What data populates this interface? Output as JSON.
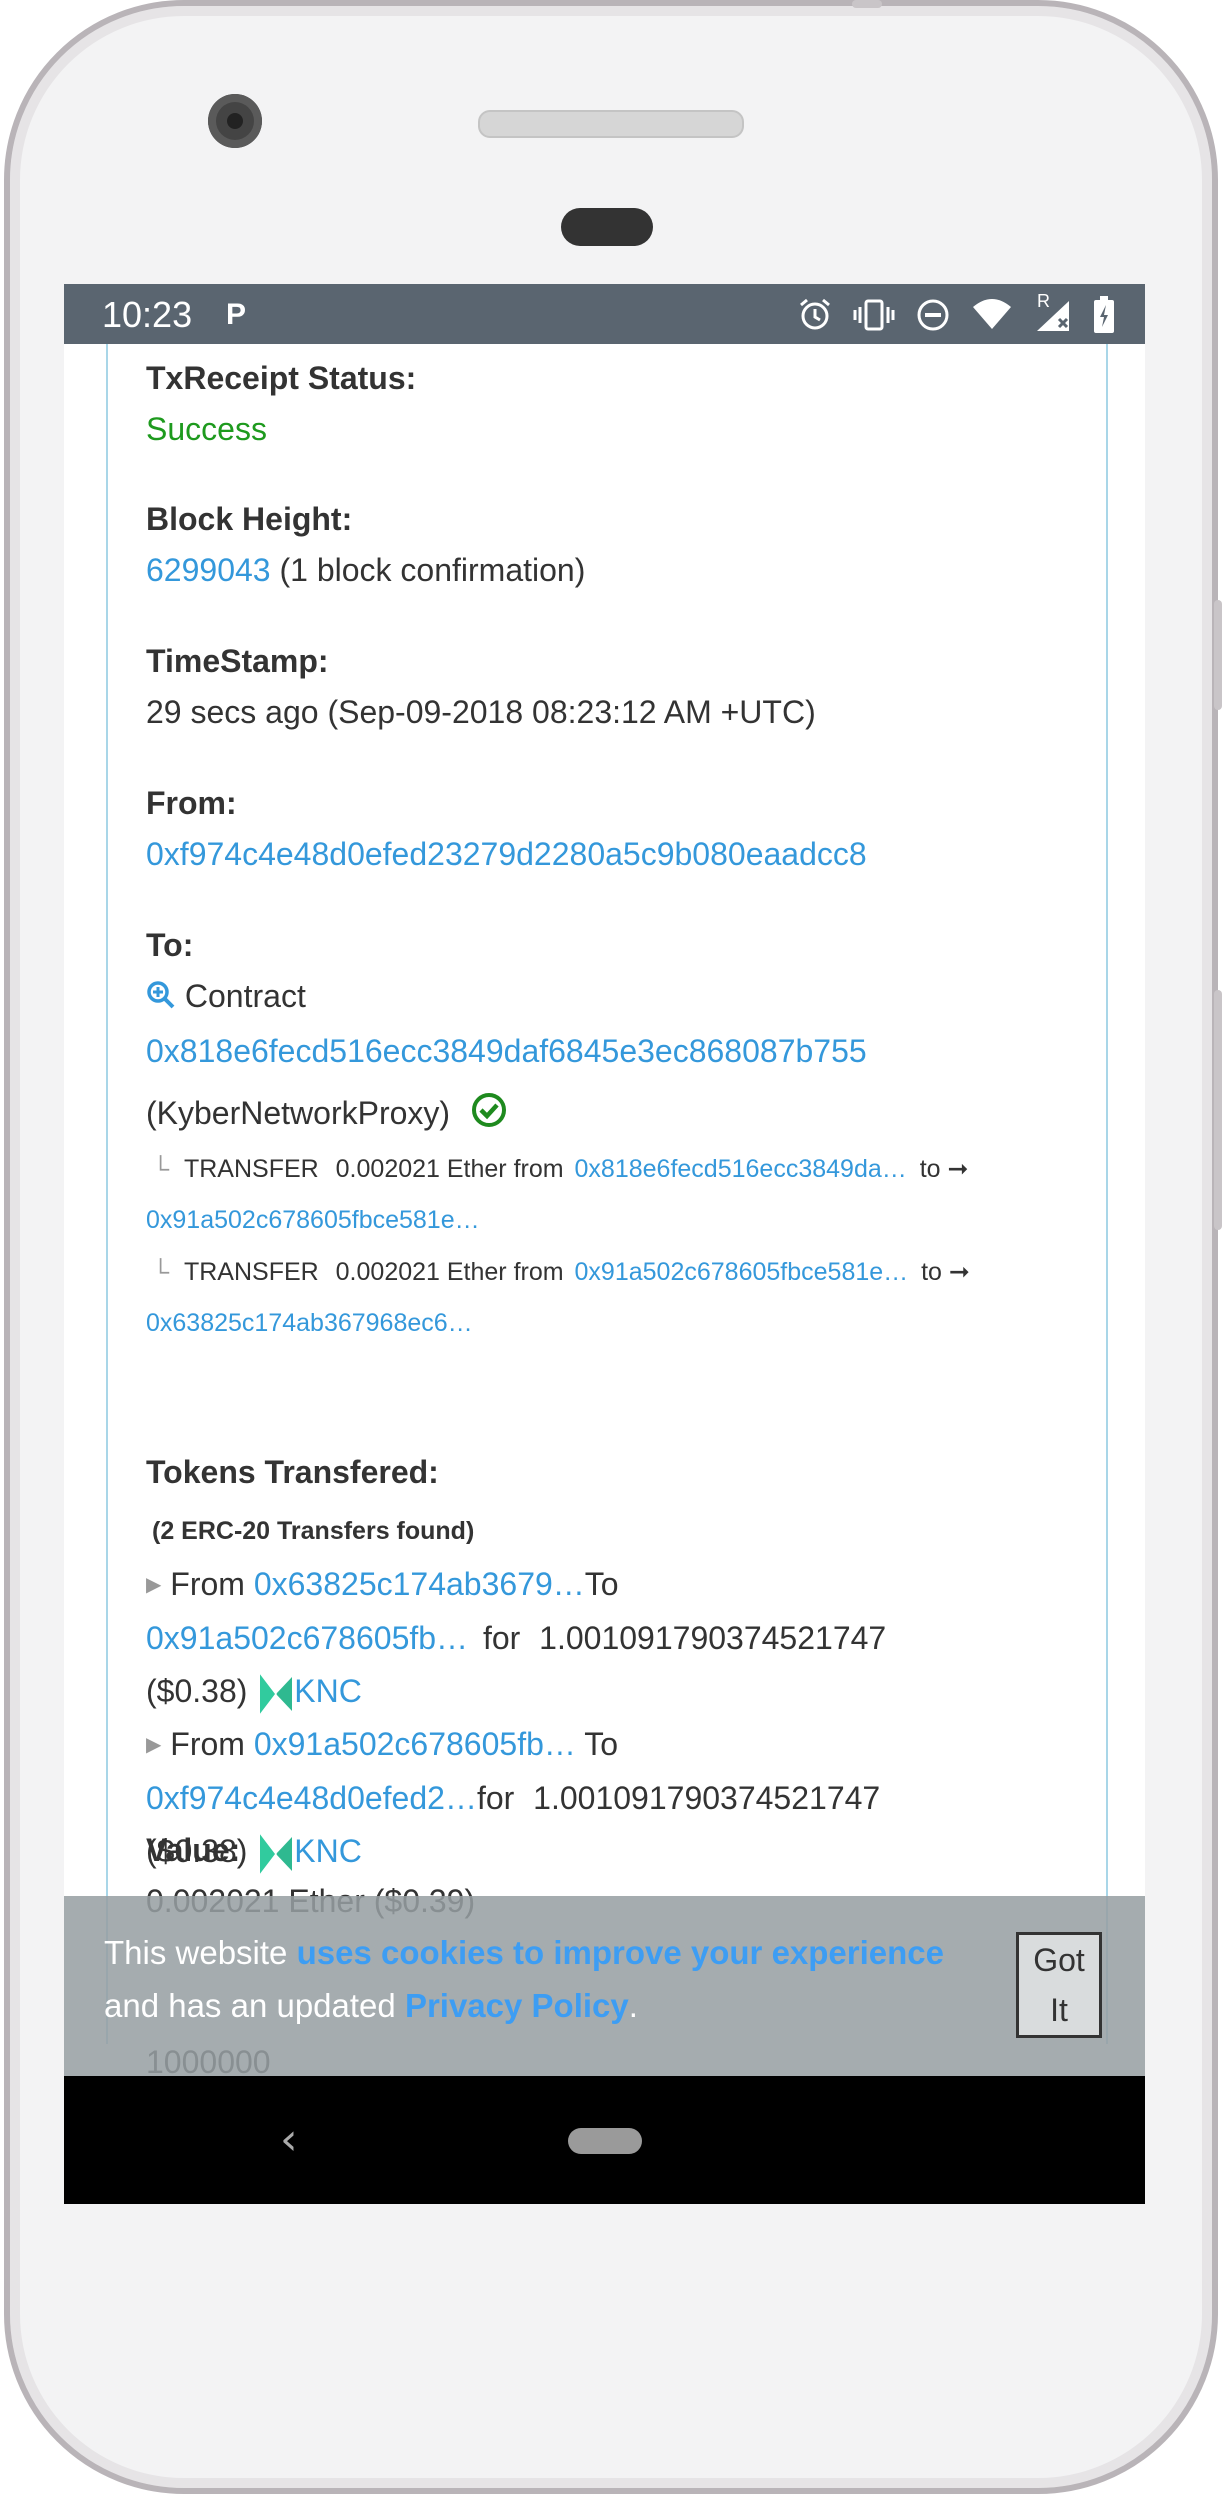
{
  "status_bar": {
    "time": "10:23",
    "notification_icon": "P",
    "icons": [
      "alarm-icon",
      "vibrate-icon",
      "dnd-icon",
      "wifi-icon",
      "signal-icon",
      "battery-icon"
    ],
    "roaming_marker": "R"
  },
  "tx": {
    "receipt_label": "TxReceipt Status:",
    "receipt_value": "Success",
    "block_label": "Block Height:",
    "block_number": "6299043",
    "block_confirm": "(1 block confirmation)",
    "time_label": "TimeStamp:",
    "time_value": "29 secs ago (Sep-09-2018 08:23:12 AM +UTC)",
    "from_label": "From:",
    "from_address": "0xf974c4e48d0efed23279d2280a5c9b080eaadcc8",
    "to_label": "To:",
    "to_contract_word": "Contract",
    "to_address": "0x818e6fecd516ecc3849daf6845e3ec868087b755",
    "to_name": "(KyberNetworkProxy)",
    "internal": [
      {
        "tree": "└",
        "type": "TRANSFER",
        "amount": "0.002021 Ether from",
        "from": "0x818e6fecd516ecc3849da…",
        "to_word": "to ➞",
        "to": "0x91a502c678605fbce581e…"
      },
      {
        "tree": "└",
        "type": "TRANSFER",
        "amount": "0.002021 Ether from",
        "from": "0x91a502c678605fbce581e…",
        "to_word": "to ➞",
        "to": "0x63825c174ab367968ec6…"
      }
    ],
    "tokens_label": "Tokens Transfered:",
    "tokens_count": "(2 ERC-20 Transfers found)",
    "token_transfers": [
      {
        "from_word": "From",
        "from": "0x63825c174ab3679…",
        "to_word": "To",
        "to": "0x91a502c678605fb…",
        "for_word": "for",
        "amount": "1.001091790374521747",
        "usd": "($0.38)",
        "token": "KNC"
      },
      {
        "from_word": "From",
        "from": "0x91a502c678605fb…",
        "to_word": "To",
        "to": "0xf974c4e48d0efed2…",
        "for_word": "for",
        "amount": "1.001091790374521747",
        "usd": "($0.38)",
        "token": "KNC"
      }
    ],
    "value_label": "Value:",
    "value_text": "0.002021 Ether ($0.39)",
    "gas_limit_text": "1000000"
  },
  "cookie": {
    "text1": "This website ",
    "link1": "uses cookies to improve your experience",
    "text2": " and has an updated ",
    "link2": "Privacy Policy",
    "text3": ".",
    "button_line1": "Got",
    "button_line2": "It"
  },
  "nav": {
    "back_glyph": "‹"
  },
  "colors": {
    "link": "#3498db",
    "success": "#1e9a1e",
    "status_bar": "#5a6570",
    "knc": "#31cb9e"
  }
}
